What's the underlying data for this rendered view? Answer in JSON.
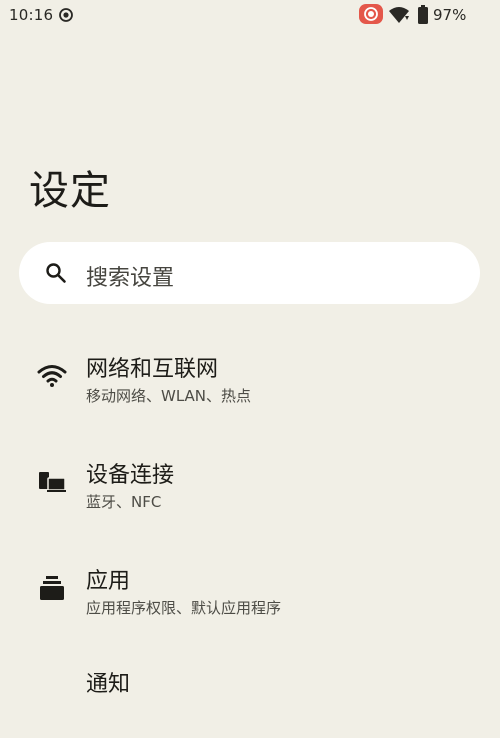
{
  "status_bar": {
    "time": "10:16",
    "battery": "97%",
    "icons": [
      "sync-icon",
      "screen-record-icon",
      "wifi-icon",
      "battery-icon"
    ],
    "record_color": "#e4574a"
  },
  "page": {
    "title": "设定"
  },
  "search": {
    "placeholder": "搜索设置"
  },
  "settings_items": [
    {
      "title": "网络和互联网",
      "subtitle": "移动网络、WLAN、热点",
      "icon": "wifi-icon"
    },
    {
      "title": "设备连接",
      "subtitle": "蓝牙、NFC",
      "icon": "devices-icon"
    },
    {
      "title": "应用",
      "subtitle": "应用程序权限、默认应用程序",
      "icon": "apps-icon"
    },
    {
      "title": "通知",
      "subtitle": "",
      "icon": "notifications-icon"
    }
  ],
  "colors": {
    "background": "#f1efe6",
    "search_bg": "#ffffff",
    "text_primary": "#1d1c18",
    "text_secondary": "#4d4c46"
  }
}
